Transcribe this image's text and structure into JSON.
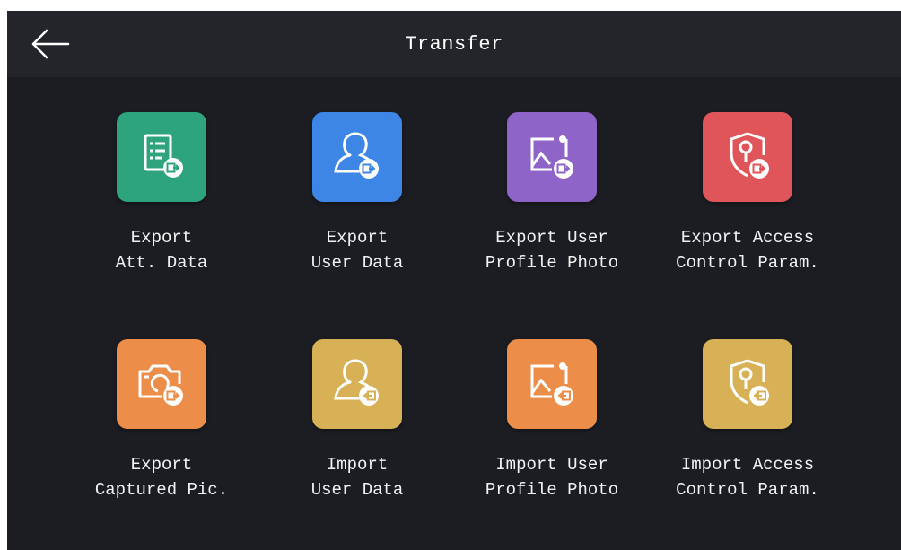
{
  "header": {
    "title": "Transfer",
    "back_icon": "arrow-left-icon"
  },
  "tiles": [
    {
      "id": "export-att-data",
      "line1": "Export",
      "line2": "Att. Data",
      "icon": "document-export-icon",
      "color": "#2ea47e"
    },
    {
      "id": "export-user-data",
      "line1": "Export",
      "line2": "User Data",
      "icon": "user-export-icon",
      "color": "#3d86e6"
    },
    {
      "id": "export-user-profile-photo",
      "line1": "Export User",
      "line2": "Profile Photo",
      "icon": "image-export-icon",
      "color": "#8e64c8"
    },
    {
      "id": "export-access-control-param",
      "line1": "Export Access",
      "line2": "Control Param.",
      "icon": "shield-export-icon",
      "color": "#e0555a"
    },
    {
      "id": "export-captured-pic",
      "line1": "Export",
      "line2": "Captured Pic.",
      "icon": "camera-export-icon",
      "color": "#ec8e4a"
    },
    {
      "id": "import-user-data",
      "line1": "Import",
      "line2": "User Data",
      "icon": "user-import-icon",
      "color": "#d8b055"
    },
    {
      "id": "import-user-profile-photo",
      "line1": "Import User",
      "line2": "Profile Photo",
      "icon": "image-import-icon",
      "color": "#ec8e4a"
    },
    {
      "id": "import-access-control-param",
      "line1": "Import Access",
      "line2": "Control Param.",
      "icon": "shield-import-icon",
      "color": "#d8b055"
    }
  ]
}
